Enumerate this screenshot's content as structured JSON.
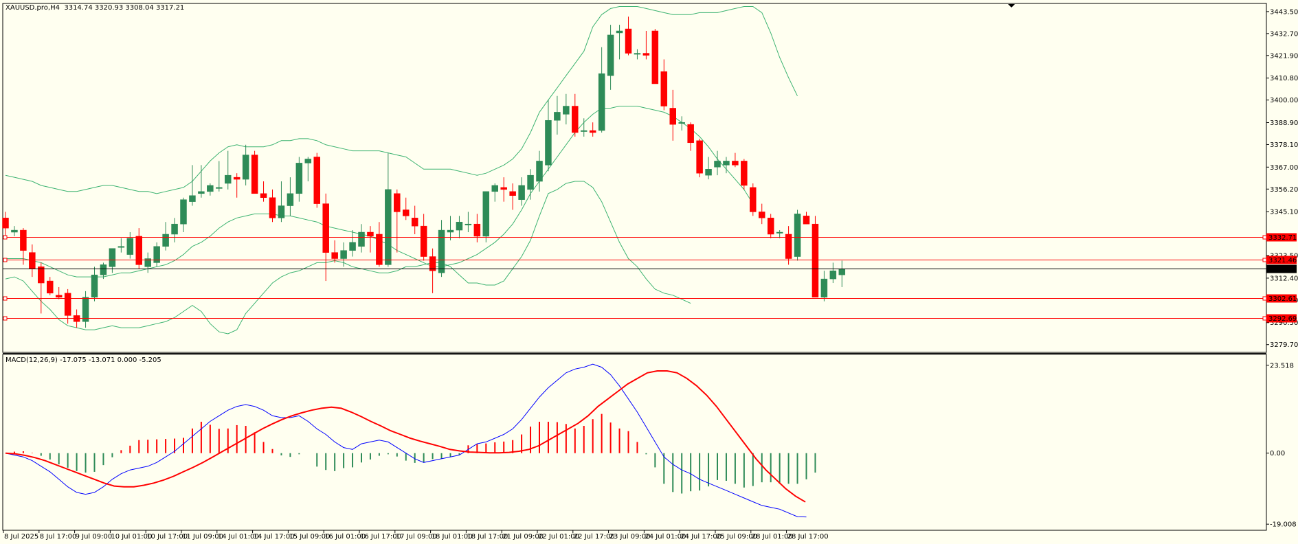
{
  "colors": {
    "background": "#fffff0",
    "bull": "#2e8b57",
    "bear": "#ff0000",
    "bollinger": "#3cb371",
    "macd_signal": "#ff0000",
    "macd_main": "#0000ff",
    "level_line": "#ff0000",
    "price_line": "#000000"
  },
  "header": {
    "symbol_text": "XAUUSD.pro,H4",
    "ohlc_text": "3314.74 3320.93 3308.04 3317.21",
    "macd_text": "MACD(12,26,9) -17.075 -13.071 0.000 -5.205"
  },
  "price_axis": {
    "ticks": [
      "3443.50",
      "3432.70",
      "3421.90",
      "3410.80",
      "3400.00",
      "3388.90",
      "3378.10",
      "3367.00",
      "3356.20",
      "3345.10",
      "3323.50",
      "3312.40",
      "3301.60",
      "3290.50",
      "3279.70"
    ]
  },
  "badges": [
    {
      "text": "3332.71",
      "style": "red",
      "price": 3332.71
    },
    {
      "text": "3321.46",
      "style": "red",
      "price": 3321.46
    },
    {
      "text": "3317.21",
      "style": "black",
      "price": 3317.21
    },
    {
      "text": "3302.61",
      "style": "red",
      "price": 3302.61
    },
    {
      "text": "3292.69",
      "style": "red",
      "price": 3292.69
    }
  ],
  "macd_axis": {
    "ticks": [
      "23.518",
      "0.00",
      "-19.008"
    ]
  },
  "time_axis": {
    "ticks": [
      "8 Jul 2025",
      "8 Jul 17:00",
      "9 Jul 09:00",
      "10 Jul 01:00",
      "10 Jul 17:00",
      "11 Jul 09:00",
      "14 Jul 01:00",
      "14 Jul 17:00",
      "15 Jul 09:00",
      "16 Jul 01:00",
      "16 Jul 17:00",
      "17 Jul 09:00",
      "18 Jul 01:00",
      "18 Jul 17:00",
      "21 Jul 09:00",
      "22 Jul 01:00",
      "22 Jul 17:00",
      "23 Jul 09:00",
      "24 Jul 01:00",
      "24 Jul 17:00",
      "25 Jul 09:00",
      "28 Jul 01:00",
      "28 Jul 17:00"
    ]
  },
  "chart_data": {
    "type": "candlestick",
    "symbol": "XAUUSD.pro",
    "timeframe": "H4",
    "price_range": [
      3276.9,
      3446.5
    ],
    "macd_range": [
      -19.9,
      25.5
    ],
    "candles": [
      [
        3342,
        3345,
        3333,
        3337
      ],
      [
        3335,
        3338,
        3333,
        3336
      ],
      [
        3336,
        3337,
        3319,
        3326
      ],
      [
        3325,
        3329,
        3313,
        3317
      ],
      [
        3318,
        3320,
        3295,
        3310
      ],
      [
        3311,
        3313,
        3304,
        3305
      ],
      [
        3304,
        3308,
        3302,
        3303
      ],
      [
        3305,
        3307,
        3290,
        3294
      ],
      [
        3294,
        3297,
        3288,
        3291
      ],
      [
        3291,
        3306,
        3288,
        3303
      ],
      [
        3303,
        3318,
        3301,
        3314
      ],
      [
        3314,
        3320,
        3312,
        3319
      ],
      [
        3318,
        3327,
        3315,
        3327
      ],
      [
        3328,
        3332,
        3325,
        3328
      ],
      [
        3324,
        3335,
        3322,
        3332
      ],
      [
        3333,
        3337,
        3317,
        3319
      ],
      [
        3318,
        3325,
        3315,
        3322
      ],
      [
        3320,
        3330,
        3318,
        3328
      ],
      [
        3328,
        3340,
        3326,
        3334
      ],
      [
        3334,
        3342,
        3330,
        3339
      ],
      [
        3339,
        3352,
        3335,
        3351
      ],
      [
        3350,
        3368,
        3348,
        3353
      ],
      [
        3354,
        3368,
        3352,
        3355
      ],
      [
        3355,
        3359,
        3353,
        3358
      ],
      [
        3357,
        3370,
        3355,
        3357
      ],
      [
        3359,
        3375,
        3356,
        3363
      ],
      [
        3362,
        3364,
        3352,
        3361
      ],
      [
        3361,
        3378,
        3358,
        3373
      ],
      [
        3373,
        3375,
        3355,
        3354
      ],
      [
        3354,
        3360,
        3350,
        3352
      ],
      [
        3352,
        3356,
        3340,
        3342
      ],
      [
        3342,
        3360,
        3340,
        3348
      ],
      [
        3348,
        3362,
        3343,
        3354
      ],
      [
        3354,
        3372,
        3350,
        3369
      ],
      [
        3369,
        3372,
        3360,
        3371
      ],
      [
        3372,
        3374,
        3347,
        3349
      ],
      [
        3349,
        3354,
        3311,
        3325
      ],
      [
        3325,
        3331,
        3320,
        3322
      ],
      [
        3322,
        3330,
        3318,
        3326
      ],
      [
        3326,
        3336,
        3323,
        3330
      ],
      [
        3328,
        3339,
        3325,
        3335
      ],
      [
        3335,
        3338,
        3325,
        3333
      ],
      [
        3334,
        3340,
        3318,
        3319
      ],
      [
        3319,
        3374,
        3318,
        3356
      ],
      [
        3354,
        3356,
        3325,
        3345
      ],
      [
        3346,
        3352,
        3341,
        3343
      ],
      [
        3342,
        3348,
        3334,
        3338
      ],
      [
        3338,
        3344,
        3321,
        3323
      ],
      [
        3323,
        3327,
        3305,
        3316
      ],
      [
        3315,
        3341,
        3313,
        3336
      ],
      [
        3335,
        3343,
        3331,
        3336
      ],
      [
        3336,
        3343,
        3332,
        3340
      ],
      [
        3339,
        3345,
        3335,
        3339
      ],
      [
        3339,
        3344,
        3330,
        3333
      ],
      [
        3333,
        3350,
        3330,
        3355
      ],
      [
        3355,
        3359,
        3350,
        3358
      ],
      [
        3357,
        3362,
        3350,
        3356
      ],
      [
        3355,
        3359,
        3346,
        3353
      ],
      [
        3351,
        3362,
        3348,
        3358
      ],
      [
        3356,
        3366,
        3351,
        3363
      ],
      [
        3360,
        3375,
        3355,
        3370
      ],
      [
        3368,
        3400,
        3365,
        3390
      ],
      [
        3390,
        3402,
        3383,
        3394
      ],
      [
        3393,
        3403,
        3388,
        3397
      ],
      [
        3397,
        3403,
        3382,
        3384
      ],
      [
        3385,
        3391,
        3382,
        3385
      ],
      [
        3385,
        3389,
        3382,
        3384
      ],
      [
        3385,
        3426,
        3384,
        3413
      ],
      [
        3412,
        3437,
        3405,
        3432
      ],
      [
        3433,
        3437,
        3420,
        3434
      ],
      [
        3435,
        3441,
        3422,
        3423
      ],
      [
        3423,
        3425,
        3420,
        3423
      ],
      [
        3423,
        3434,
        3420,
        3422
      ],
      [
        3434,
        3435,
        3410,
        3408
      ],
      [
        3414,
        3420,
        3395,
        3397
      ],
      [
        3396,
        3405,
        3380,
        3388
      ],
      [
        3389,
        3392,
        3385,
        3389
      ],
      [
        3388,
        3389,
        3375,
        3379
      ],
      [
        3380,
        3381,
        3362,
        3364
      ],
      [
        3363,
        3372,
        3361,
        3366
      ],
      [
        3367,
        3375,
        3363,
        3370
      ],
      [
        3368,
        3372,
        3364,
        3370
      ],
      [
        3370,
        3374,
        3367,
        3368
      ],
      [
        3370,
        3371,
        3356,
        3358
      ],
      [
        3357,
        3359,
        3343,
        3345
      ],
      [
        3345,
        3349,
        3339,
        3342
      ],
      [
        3342,
        3344,
        3332,
        3334
      ],
      [
        3335,
        3336,
        3332,
        3335
      ],
      [
        3334,
        3338,
        3319,
        3322
      ],
      [
        3323,
        3346,
        3321,
        3344
      ],
      [
        3343,
        3345,
        3339,
        3339
      ],
      [
        3339,
        3343,
        3303,
        3303
      ],
      [
        3303,
        3316,
        3301,
        3312
      ],
      [
        3312,
        3320,
        3310,
        3316
      ],
      [
        3314,
        3321,
        3308,
        3317
      ]
    ],
    "bollinger": {
      "upper": [
        3363,
        3362,
        3361,
        3360,
        3358,
        3357,
        3356,
        3355,
        3355,
        3356,
        3357,
        3358,
        3358,
        3357,
        3356,
        3355,
        3355,
        3354,
        3355,
        3356,
        3357,
        3360,
        3365,
        3370,
        3374,
        3377,
        3378,
        3377,
        3377,
        3377,
        3378,
        3380,
        3380,
        3381,
        3381,
        3380,
        3378,
        3377,
        3376,
        3375,
        3375,
        3375,
        3375,
        3374,
        3373,
        3372,
        3369,
        3366,
        3366,
        3366,
        3366,
        3365,
        3364,
        3363,
        3364,
        3366,
        3368,
        3371,
        3376,
        3384,
        3394,
        3400,
        3406,
        3412,
        3418,
        3424,
        3436,
        3442,
        3445,
        3446,
        3446,
        3446,
        3445,
        3444,
        3443,
        3442,
        3442,
        3442,
        3443,
        3443,
        3443,
        3444,
        3445,
        3446,
        3446,
        3443,
        3433,
        3421,
        3411,
        3402
      ],
      "middle": [
        3322,
        3322,
        3322,
        3321,
        3320,
        3318,
        3316,
        3314,
        3313,
        3313,
        3313,
        3313,
        3314,
        3315,
        3315,
        3316,
        3317,
        3318,
        3319,
        3321,
        3324,
        3328,
        3330,
        3333,
        3337,
        3340,
        3342,
        3343,
        3344,
        3344,
        3344,
        3343,
        3343,
        3342,
        3341,
        3340,
        3338,
        3337,
        3336,
        3335,
        3334,
        3333,
        3331,
        3329,
        3326,
        3324,
        3322,
        3320,
        3318,
        3318,
        3319,
        3320,
        3322,
        3324,
        3327,
        3330,
        3334,
        3339,
        3346,
        3354,
        3360,
        3366,
        3372,
        3378,
        3384,
        3389,
        3393,
        3396,
        3396,
        3397,
        3397,
        3397,
        3396,
        3395,
        3394,
        3392,
        3389,
        3386,
        3382,
        3377,
        3371,
        3366,
        3361,
        3356,
        3349
      ],
      "lower": [
        3312,
        3313,
        3311,
        3306,
        3301,
        3297,
        3292,
        3289,
        3288,
        3287,
        3287,
        3288,
        3289,
        3288,
        3288,
        3288,
        3289,
        3290,
        3291,
        3293,
        3296,
        3299,
        3296,
        3290,
        3286,
        3285,
        3287,
        3295,
        3300,
        3305,
        3310,
        3313,
        3315,
        3316,
        3318,
        3320,
        3320,
        3321,
        3320,
        3318,
        3317,
        3316,
        3315,
        3315,
        3316,
        3318,
        3318,
        3319,
        3320,
        3320,
        3318,
        3314,
        3310,
        3310,
        3309,
        3309,
        3311,
        3317,
        3323,
        3331,
        3343,
        3354,
        3356,
        3359,
        3360,
        3360,
        3357,
        3350,
        3340,
        3330,
        3322,
        3318,
        3312,
        3307,
        3305,
        3304,
        3302,
        3300
      ]
    },
    "macd": {
      "histogram": [
        0.0,
        0.4,
        0.5,
        0.1,
        -0.7,
        -1.7,
        -3.0,
        -3.9,
        -4.8,
        -5.2,
        -5.0,
        -3.2,
        -1.1,
        0.8,
        2.0,
        3.5,
        3.6,
        3.7,
        3.8,
        3.9,
        4.1,
        6.6,
        8.4,
        7.6,
        6.5,
        6.6,
        7.5,
        7.3,
        5.6,
        3.0,
        1.1,
        -0.6,
        -1.0,
        -0.3,
        0.0,
        -3.6,
        -4.5,
        -4.8,
        -4.0,
        -3.8,
        -2.5,
        -1.7,
        -0.7,
        -0.3,
        -0.9,
        -2.0,
        -2.6,
        -2.4,
        -1.6,
        -1.5,
        -1.1,
        -0.5,
        2.1,
        2.4,
        2.6,
        2.9,
        3.1,
        3.5,
        5.0,
        7.1,
        8.4,
        8.4,
        8.3,
        7.8,
        6.6,
        7.3,
        9.1,
        10.5,
        8.2,
        6.6,
        5.9,
        3.0,
        -0.3,
        -3.8,
        -8.2,
        -10.4,
        -10.8,
        -10.2,
        -10.0,
        -8.9,
        -7.2,
        -7.4,
        -8.2,
        -9.2,
        -8.8,
        -7.8,
        -7.8,
        -8.2,
        -8.2,
        -8.2,
        -7.0,
        -5.2
      ],
      "main": [
        0.0,
        -0.5,
        -1.0,
        -2.0,
        -3.5,
        -5.0,
        -7.0,
        -9.0,
        -10.5,
        -11.0,
        -10.5,
        -9.0,
        -7.0,
        -5.5,
        -4.5,
        -4.0,
        -3.5,
        -2.5,
        -1.0,
        0.5,
        2.5,
        4.5,
        6.5,
        8.5,
        10.0,
        11.5,
        12.5,
        13.0,
        12.5,
        11.5,
        10.0,
        9.5,
        9.5,
        10.0,
        8.5,
        6.5,
        5.0,
        3.0,
        1.5,
        1.0,
        2.5,
        3.0,
        3.5,
        3.0,
        1.5,
        0.0,
        -1.5,
        -2.5,
        -2.0,
        -1.5,
        -1.0,
        -0.5,
        1.0,
        2.5,
        3.0,
        4.0,
        5.0,
        6.5,
        9.0,
        12.0,
        15.0,
        17.5,
        19.5,
        21.5,
        22.5,
        23.0,
        23.8,
        23.0,
        21.0,
        18.0,
        14.5,
        11.0,
        7.0,
        3.0,
        -1.0,
        -3.0,
        -4.5,
        -5.5,
        -7.0,
        -8.0,
        -9.0,
        -10.0,
        -11.0,
        -12.0,
        -13.0,
        -14.0,
        -14.5,
        -15.0,
        -16.0,
        -17.0,
        -17.075
      ],
      "signal": [
        0.0,
        -0.2,
        -0.6,
        -1.2,
        -2.0,
        -3.0,
        -4.0,
        -5.0,
        -6.0,
        -7.0,
        -8.0,
        -8.8,
        -9.0,
        -9.0,
        -8.6,
        -8.0,
        -7.2,
        -6.2,
        -5.0,
        -3.8,
        -2.5,
        -1.0,
        0.5,
        2.0,
        3.5,
        5.0,
        6.5,
        7.8,
        9.0,
        10.0,
        10.8,
        11.5,
        12.0,
        12.3,
        12.0,
        11.0,
        9.8,
        8.5,
        7.3,
        6.0,
        5.0,
        4.0,
        3.2,
        2.5,
        1.8,
        1.0,
        0.6,
        0.3,
        0.2,
        0.1,
        0.1,
        0.2,
        0.5,
        1.0,
        2.0,
        3.5,
        5.0,
        6.5,
        8.0,
        10.0,
        12.5,
        14.5,
        16.5,
        18.5,
        20.0,
        21.5,
        22.0,
        22.0,
        21.5,
        20.0,
        18.0,
        15.5,
        12.5,
        9.0,
        5.5,
        2.0,
        -1.5,
        -4.5,
        -7.0,
        -9.5,
        -11.5,
        -13.071
      ]
    }
  }
}
